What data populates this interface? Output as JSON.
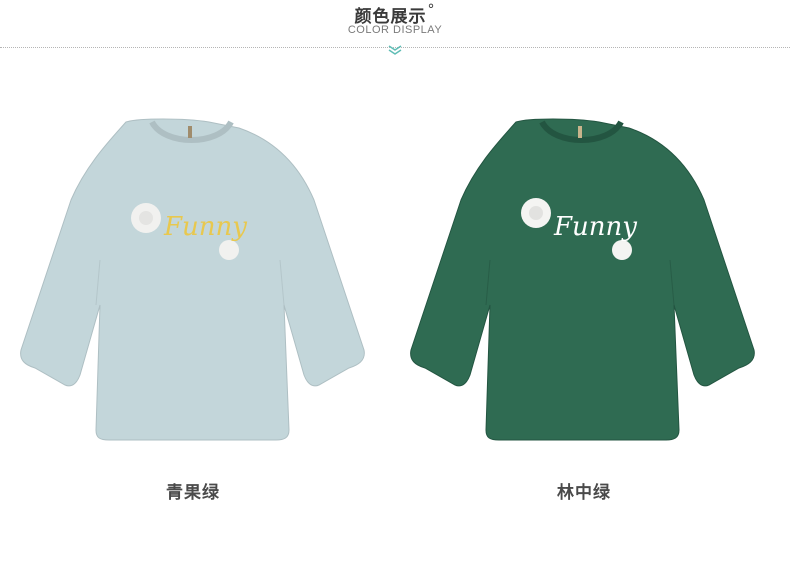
{
  "header": {
    "title": "颜色展示",
    "title_mark": "°",
    "subtitle": "COLOR DISPLAY",
    "chevron_icon": "double-chevron-down-icon"
  },
  "products": [
    {
      "color_name": "青果绿",
      "print_text": "Funny",
      "shirt_color": "#c3d6da",
      "print_color": "#e8c84e"
    },
    {
      "color_name": "林中绿",
      "print_text": "Funny",
      "shirt_color": "#2f6b52",
      "print_color": "#ffffff"
    }
  ]
}
